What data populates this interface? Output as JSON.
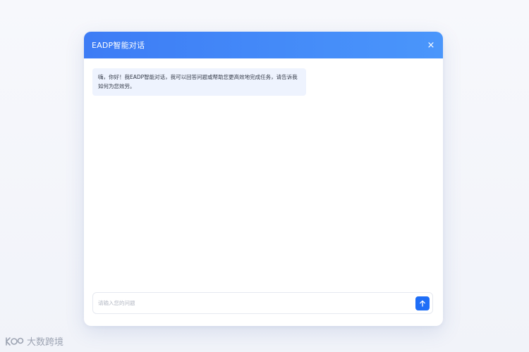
{
  "dialog": {
    "title": "EADP智能对话",
    "close_icon": "close-icon",
    "close_glyph": "×"
  },
  "messages": [
    {
      "role": "assistant",
      "text": "嗨，你好！我EADP智能对话，我可以回答问题或帮助您更高效地完成任务，请告诉我如何为您效劳。"
    }
  ],
  "composer": {
    "value": "",
    "placeholder": "请输入您的问题",
    "send_icon": "arrow-up-icon"
  },
  "watermark": {
    "text": "大数跨境",
    "logo_icon": "brand-logo-icon"
  },
  "colors": {
    "header_start": "#3d7cf5",
    "header_end": "#4a96fb",
    "bubble_bg": "#eef3fe",
    "send_button": "#1f6ef7"
  }
}
